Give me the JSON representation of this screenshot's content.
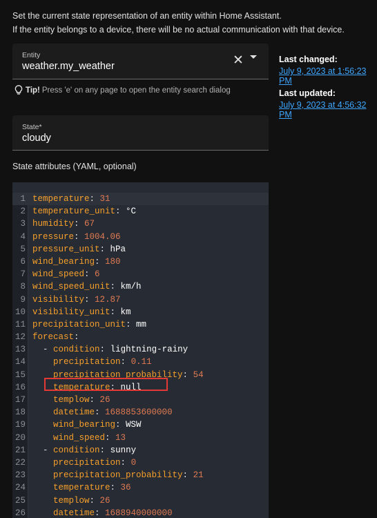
{
  "intro": {
    "line1": "Set the current state representation of an entity within Home Assistant.",
    "line2": "If the entity belongs to a device, there will be no actual communication with that device."
  },
  "entity_field": {
    "label": "Entity",
    "value": "weather.my_weather"
  },
  "tip": {
    "bold": "Tip!",
    "text": "Press 'e' on any page to open the entity search dialog"
  },
  "state_field": {
    "label": "State*",
    "value": "cloudy"
  },
  "attributes_label": "State attributes (YAML, optional)",
  "last_changed": {
    "label": "Last changed:",
    "value": "July 9, 2023 at 1:56:23 PM"
  },
  "last_updated": {
    "label": "Last updated:",
    "value": "July 9, 2023 at 4:56:32 PM"
  },
  "editor": {
    "lines": [
      {
        "num": "1",
        "indent": "",
        "dash": "",
        "key": "temperature",
        "val": "31",
        "type": "n"
      },
      {
        "num": "2",
        "indent": "",
        "dash": "",
        "key": "temperature_unit",
        "val": "°C",
        "type": "s"
      },
      {
        "num": "3",
        "indent": "",
        "dash": "",
        "key": "humidity",
        "val": "67",
        "type": "n"
      },
      {
        "num": "4",
        "indent": "",
        "dash": "",
        "key": "pressure",
        "val": "1004.06",
        "type": "n"
      },
      {
        "num": "5",
        "indent": "",
        "dash": "",
        "key": "pressure_unit",
        "val": "hPa",
        "type": "s"
      },
      {
        "num": "6",
        "indent": "",
        "dash": "",
        "key": "wind_bearing",
        "val": "180",
        "type": "n"
      },
      {
        "num": "7",
        "indent": "",
        "dash": "",
        "key": "wind_speed",
        "val": "6",
        "type": "n"
      },
      {
        "num": "8",
        "indent": "",
        "dash": "",
        "key": "wind_speed_unit",
        "val": "km/h",
        "type": "s"
      },
      {
        "num": "9",
        "indent": "",
        "dash": "",
        "key": "visibility",
        "val": "12.87",
        "type": "n"
      },
      {
        "num": "10",
        "indent": "",
        "dash": "",
        "key": "visibility_unit",
        "val": "km",
        "type": "s"
      },
      {
        "num": "11",
        "indent": "",
        "dash": "",
        "key": "precipitation_unit",
        "val": "mm",
        "type": "s"
      },
      {
        "num": "12",
        "indent": "",
        "dash": "",
        "key": "forecast",
        "val": "",
        "type": "s"
      },
      {
        "num": "13",
        "indent": "  ",
        "dash": "- ",
        "key": "condition",
        "val": "lightning-rainy",
        "type": "s"
      },
      {
        "num": "14",
        "indent": "    ",
        "dash": "",
        "key": "precipitation",
        "val": "0.11",
        "type": "n"
      },
      {
        "num": "15",
        "indent": "    ",
        "dash": "",
        "key": "precipitation_probability",
        "val": "54",
        "type": "n"
      },
      {
        "num": "16",
        "indent": "    ",
        "dash": "",
        "key": "temperature",
        "val": "null",
        "type": "s"
      },
      {
        "num": "17",
        "indent": "    ",
        "dash": "",
        "key": "templow",
        "val": "26",
        "type": "n"
      },
      {
        "num": "18",
        "indent": "    ",
        "dash": "",
        "key": "datetime",
        "val": "1688853600000",
        "type": "n"
      },
      {
        "num": "19",
        "indent": "    ",
        "dash": "",
        "key": "wind_bearing",
        "val": "WSW",
        "type": "s"
      },
      {
        "num": "20",
        "indent": "    ",
        "dash": "",
        "key": "wind_speed",
        "val": "13",
        "type": "n"
      },
      {
        "num": "21",
        "indent": "  ",
        "dash": "- ",
        "key": "condition",
        "val": "sunny",
        "type": "s"
      },
      {
        "num": "22",
        "indent": "    ",
        "dash": "",
        "key": "precipitation",
        "val": "0",
        "type": "n"
      },
      {
        "num": "23",
        "indent": "    ",
        "dash": "",
        "key": "precipitation_probability",
        "val": "21",
        "type": "n"
      },
      {
        "num": "24",
        "indent": "    ",
        "dash": "",
        "key": "temperature",
        "val": "36",
        "type": "n"
      },
      {
        "num": "25",
        "indent": "    ",
        "dash": "",
        "key": "templow",
        "val": "26",
        "type": "n"
      },
      {
        "num": "26",
        "indent": "    ",
        "dash": "",
        "key": "datetime",
        "val": "1688940000000",
        "type": "n"
      }
    ]
  }
}
